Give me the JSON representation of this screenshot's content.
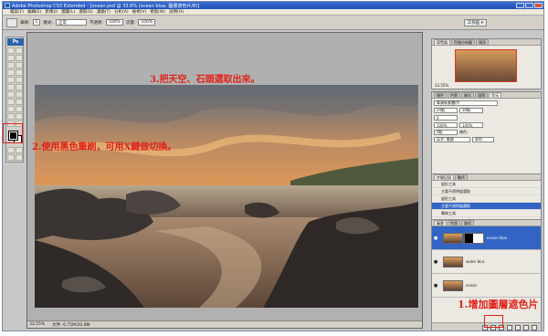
{
  "window": {
    "title": "Adobe Photoshop CS3 Extended - [ocean.psd @ 33.6% (ocean blue, 圖層遮色片/8)]"
  },
  "menu": [
    "檔案(F)",
    "編輯(E)",
    "影像(I)",
    "圖層(L)",
    "選取(S)",
    "濾鏡(T)",
    "分析(A)",
    "檢視(V)",
    "視窗(W)",
    "說明(H)"
  ],
  "options": {
    "brush_label": "筆刷:",
    "brush_size": "1",
    "mode_label": "模式:",
    "mode_value": "正常",
    "opacity_label": "不透明:",
    "opacity_value": "100%",
    "flow_label": "流量:",
    "flow_value": "100%",
    "workspace_label": "工作區 ▾"
  },
  "toolbox": {
    "logo": "Ps"
  },
  "document": {
    "zoom": "33.55%",
    "doc_info": "文件: 6.75M/20.8M"
  },
  "annotations": {
    "step1": "1.增加圖層遮色片",
    "step2": "2.使用黑色筆刷，可用X鍵做切換。",
    "step3": "3.把天空、石頭選取出來。"
  },
  "navigator": {
    "tabs": [
      "導覽器",
      "色階分佈圖",
      "資訊"
    ],
    "zoom": "33.55%"
  },
  "character": {
    "tabs": [
      "顏色",
      "色票",
      "樣式",
      "段落",
      "字元"
    ],
    "font": "華康新篆體(P)",
    "size": "24點",
    "leading": "30點",
    "tracking": "0",
    "scale_v": "100%",
    "scale_h": "100%",
    "baseline": "0點",
    "color_label": "顏色:",
    "lang": "英文: 美國",
    "aa": "犀利"
  },
  "history": {
    "tabs": [
      "步驟記錄",
      "動作"
    ],
    "items": [
      "變形工具",
      "主要不透明度選取",
      "變形工具",
      "主要不透明度選取",
      "筆刷工具"
    ],
    "selected_index": 3
  },
  "layers": {
    "tabs": [
      "圖層",
      "色版",
      "路徑"
    ],
    "rows": [
      {
        "name": "ocean blue",
        "has_mask": true,
        "selected": true
      },
      {
        "name": "water blur",
        "has_mask": false,
        "selected": false
      },
      {
        "name": "ocean",
        "has_mask": false,
        "selected": false
      }
    ]
  },
  "colors": {
    "annotation": "#e2231a",
    "selection": "#3164c4",
    "titlebar": "#1e4fb7"
  }
}
